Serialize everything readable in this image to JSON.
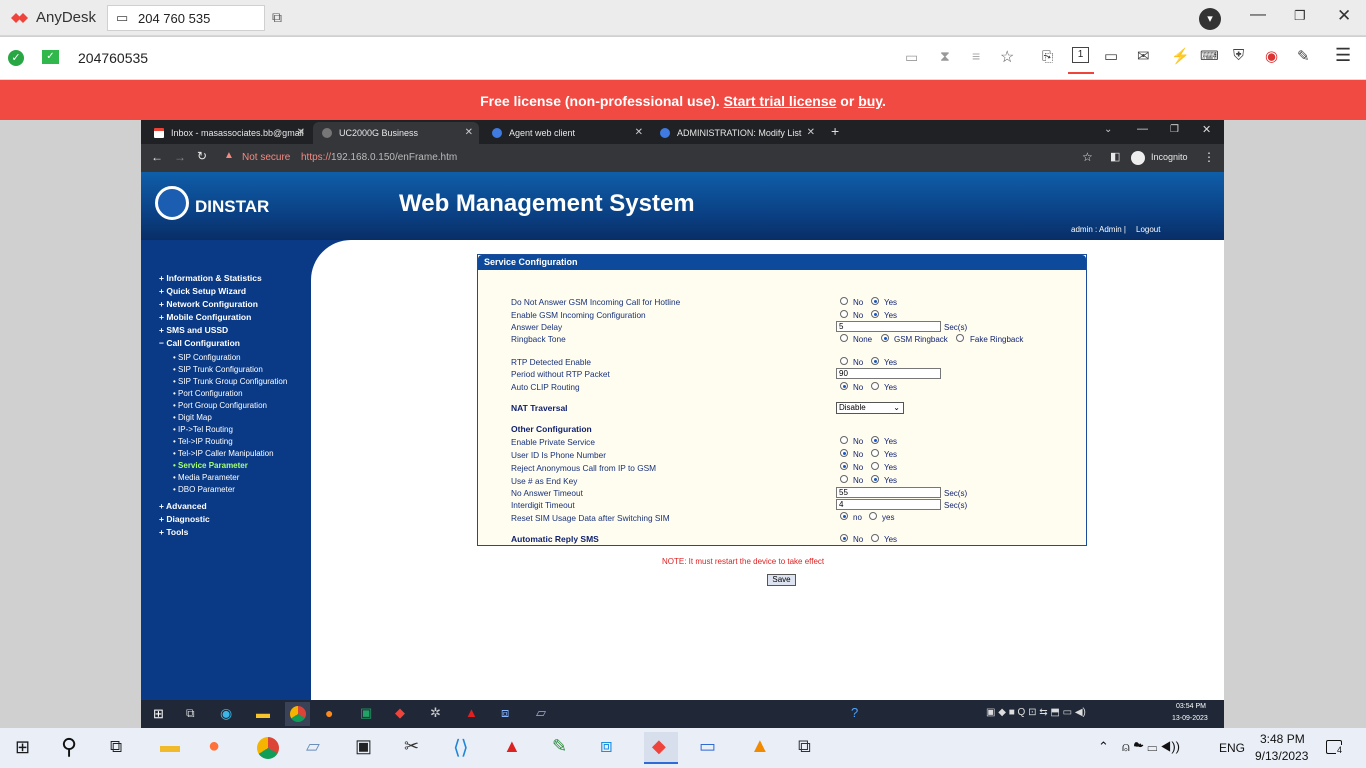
{
  "anydesk": {
    "app_name": "AnyDesk",
    "tab_id": "204 760 535",
    "address": "204760535",
    "banner": {
      "prefix": "Free license (non-professional use).",
      "trial_link": "Start trial license",
      "or": "or",
      "buy_link": "buy",
      "suffix": "."
    },
    "colors": {
      "banner": "#f04a43",
      "brand": "#ef443b"
    }
  },
  "browser": {
    "tabs": [
      {
        "title": "Inbox - masassociates.bb@gmail",
        "icon": "gmail-icon"
      },
      {
        "title": "UC2000G Business",
        "icon": "globe-icon"
      },
      {
        "title": "Agent web client",
        "icon": "agent-icon"
      },
      {
        "title": "ADMINISTRATION: Modify List",
        "icon": "agent-icon"
      }
    ],
    "not_secure": "Not secure",
    "url_scheme": "https://",
    "url_rest": "192.168.0.150/enFrame.htm",
    "incognito": "Incognito"
  },
  "web": {
    "logo": "DINSTAR",
    "title": "Web Management System",
    "user_info": "admin : Admin |",
    "logout": "Logout",
    "nav": [
      "Information & Statistics",
      "Quick Setup Wizard",
      "Network Configuration",
      "Mobile Configuration",
      "SMS and USSD",
      "Call Configuration",
      "Advanced",
      "Diagnostic",
      "Tools"
    ],
    "subnav": [
      "SIP Configuration",
      "SIP Trunk Configuration",
      "SIP Trunk Group Configuration",
      "Port Configuration",
      "Port Group Configuration",
      "Digit Map",
      "IP->Tel Routing",
      "Tel->IP Routing",
      "Tel->IP Caller Manipulation",
      "Service Parameter",
      "Media Parameter",
      "DBO Parameter"
    ],
    "panel_title": "Service Configuration",
    "fields": {
      "f1": "Do Not Answer GSM Incoming Call for Hotline",
      "f2": "Enable GSM Incoming Configuration",
      "f3": "Answer Delay",
      "f3_value": "5",
      "f4": "Ringback Tone",
      "f5": "RTP Detected Enable",
      "f6": "Period without RTP Packet",
      "f6_value": "90",
      "f7": "Auto CLIP Routing",
      "nat": "NAT Traversal",
      "nat_value": "Disable",
      "other": "Other Configuration",
      "f8": "Enable Private Service",
      "f9": "User ID Is Phone Number",
      "f10": "Reject Anonymous Call from IP to GSM",
      "f11": "Use # as End Key",
      "f12": "No Answer Timeout",
      "f12_value": "55",
      "f13": "Interdigit Timeout",
      "f13_value": "4",
      "f14": "Reset SIM Usage Data after Switching SIM",
      "auto_sms": "Automatic Reply SMS"
    },
    "opts": {
      "no": "No",
      "yes": "Yes",
      "no_l": "no",
      "yes_l": "yes",
      "none": "None",
      "gsm_ringback": "GSM Ringback",
      "fake_ringback": "Fake Ringback",
      "secs": "Sec(s)"
    },
    "note": "NOTE: It must restart the device to take effect",
    "save": "Save"
  },
  "remote_taskbar": {
    "time": "03:54 PM",
    "date": "13-09-2023"
  },
  "taskbar": {
    "lang": "ENG",
    "time": "3:48 PM",
    "date": "9/13/2023",
    "notif": "4"
  }
}
